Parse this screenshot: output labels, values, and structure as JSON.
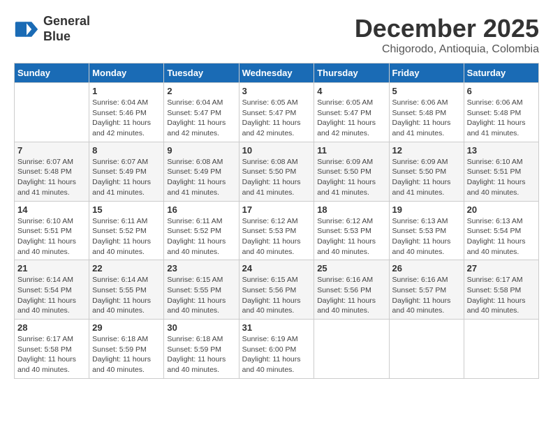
{
  "header": {
    "logo_line1": "General",
    "logo_line2": "Blue",
    "month": "December 2025",
    "location": "Chigorodo, Antioquia, Colombia"
  },
  "weekdays": [
    "Sunday",
    "Monday",
    "Tuesday",
    "Wednesday",
    "Thursday",
    "Friday",
    "Saturday"
  ],
  "weeks": [
    [
      {
        "day": "",
        "text": ""
      },
      {
        "day": "1",
        "text": "Sunrise: 6:04 AM\nSunset: 5:46 PM\nDaylight: 11 hours\nand 42 minutes."
      },
      {
        "day": "2",
        "text": "Sunrise: 6:04 AM\nSunset: 5:47 PM\nDaylight: 11 hours\nand 42 minutes."
      },
      {
        "day": "3",
        "text": "Sunrise: 6:05 AM\nSunset: 5:47 PM\nDaylight: 11 hours\nand 42 minutes."
      },
      {
        "day": "4",
        "text": "Sunrise: 6:05 AM\nSunset: 5:47 PM\nDaylight: 11 hours\nand 42 minutes."
      },
      {
        "day": "5",
        "text": "Sunrise: 6:06 AM\nSunset: 5:48 PM\nDaylight: 11 hours\nand 41 minutes."
      },
      {
        "day": "6",
        "text": "Sunrise: 6:06 AM\nSunset: 5:48 PM\nDaylight: 11 hours\nand 41 minutes."
      }
    ],
    [
      {
        "day": "7",
        "text": "Sunrise: 6:07 AM\nSunset: 5:48 PM\nDaylight: 11 hours\nand 41 minutes."
      },
      {
        "day": "8",
        "text": "Sunrise: 6:07 AM\nSunset: 5:49 PM\nDaylight: 11 hours\nand 41 minutes."
      },
      {
        "day": "9",
        "text": "Sunrise: 6:08 AM\nSunset: 5:49 PM\nDaylight: 11 hours\nand 41 minutes."
      },
      {
        "day": "10",
        "text": "Sunrise: 6:08 AM\nSunset: 5:50 PM\nDaylight: 11 hours\nand 41 minutes."
      },
      {
        "day": "11",
        "text": "Sunrise: 6:09 AM\nSunset: 5:50 PM\nDaylight: 11 hours\nand 41 minutes."
      },
      {
        "day": "12",
        "text": "Sunrise: 6:09 AM\nSunset: 5:50 PM\nDaylight: 11 hours\nand 41 minutes."
      },
      {
        "day": "13",
        "text": "Sunrise: 6:10 AM\nSunset: 5:51 PM\nDaylight: 11 hours\nand 40 minutes."
      }
    ],
    [
      {
        "day": "14",
        "text": "Sunrise: 6:10 AM\nSunset: 5:51 PM\nDaylight: 11 hours\nand 40 minutes."
      },
      {
        "day": "15",
        "text": "Sunrise: 6:11 AM\nSunset: 5:52 PM\nDaylight: 11 hours\nand 40 minutes."
      },
      {
        "day": "16",
        "text": "Sunrise: 6:11 AM\nSunset: 5:52 PM\nDaylight: 11 hours\nand 40 minutes."
      },
      {
        "day": "17",
        "text": "Sunrise: 6:12 AM\nSunset: 5:53 PM\nDaylight: 11 hours\nand 40 minutes."
      },
      {
        "day": "18",
        "text": "Sunrise: 6:12 AM\nSunset: 5:53 PM\nDaylight: 11 hours\nand 40 minutes."
      },
      {
        "day": "19",
        "text": "Sunrise: 6:13 AM\nSunset: 5:53 PM\nDaylight: 11 hours\nand 40 minutes."
      },
      {
        "day": "20",
        "text": "Sunrise: 6:13 AM\nSunset: 5:54 PM\nDaylight: 11 hours\nand 40 minutes."
      }
    ],
    [
      {
        "day": "21",
        "text": "Sunrise: 6:14 AM\nSunset: 5:54 PM\nDaylight: 11 hours\nand 40 minutes."
      },
      {
        "day": "22",
        "text": "Sunrise: 6:14 AM\nSunset: 5:55 PM\nDaylight: 11 hours\nand 40 minutes."
      },
      {
        "day": "23",
        "text": "Sunrise: 6:15 AM\nSunset: 5:55 PM\nDaylight: 11 hours\nand 40 minutes."
      },
      {
        "day": "24",
        "text": "Sunrise: 6:15 AM\nSunset: 5:56 PM\nDaylight: 11 hours\nand 40 minutes."
      },
      {
        "day": "25",
        "text": "Sunrise: 6:16 AM\nSunset: 5:56 PM\nDaylight: 11 hours\nand 40 minutes."
      },
      {
        "day": "26",
        "text": "Sunrise: 6:16 AM\nSunset: 5:57 PM\nDaylight: 11 hours\nand 40 minutes."
      },
      {
        "day": "27",
        "text": "Sunrise: 6:17 AM\nSunset: 5:58 PM\nDaylight: 11 hours\nand 40 minutes."
      }
    ],
    [
      {
        "day": "28",
        "text": "Sunrise: 6:17 AM\nSunset: 5:58 PM\nDaylight: 11 hours\nand 40 minutes."
      },
      {
        "day": "29",
        "text": "Sunrise: 6:18 AM\nSunset: 5:59 PM\nDaylight: 11 hours\nand 40 minutes."
      },
      {
        "day": "30",
        "text": "Sunrise: 6:18 AM\nSunset: 5:59 PM\nDaylight: 11 hours\nand 40 minutes."
      },
      {
        "day": "31",
        "text": "Sunrise: 6:19 AM\nSunset: 6:00 PM\nDaylight: 11 hours\nand 40 minutes."
      },
      {
        "day": "",
        "text": ""
      },
      {
        "day": "",
        "text": ""
      },
      {
        "day": "",
        "text": ""
      }
    ]
  ]
}
